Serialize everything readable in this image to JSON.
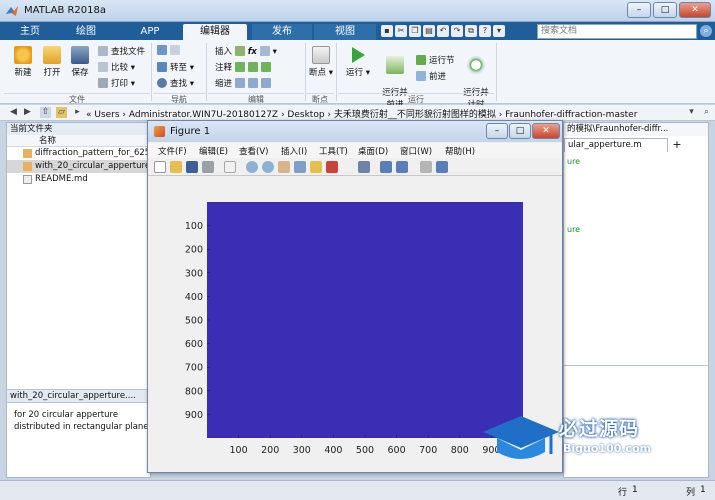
{
  "app": {
    "title": "MATLAB R2018a"
  },
  "main_tabs": [
    "主页",
    "绘图",
    "APP",
    "编辑器",
    "发布",
    "视图"
  ],
  "search": {
    "placeholder": "搜索文档"
  },
  "ribbon": {
    "file": {
      "new": "新建",
      "open": "打开",
      "save": "保存",
      "find_files": "查找文件",
      "compare": "比较",
      "print": "打印",
      "group": "文件"
    },
    "navigate": {
      "goto": "转至",
      "find": "查找",
      "group": "导航"
    },
    "edit": {
      "insert": "插入",
      "comment": "注释",
      "indent": "缩进",
      "fx": "fx",
      "group": "编辑"
    },
    "breakpoints": {
      "label": "断点",
      "group": "断点"
    },
    "run": {
      "run": "运行",
      "run_advance": "运行并\n前进",
      "run_section": "运行节",
      "advance": "前进",
      "run_time": "运行并\n计时",
      "group": "运行"
    }
  },
  "address": {
    "path": "« Users › Administrator.WIN7U-20180127Z › Desktop › 夫禾琅费衍射__不同形貌衍射图样的模拟 › Fraunhofer-diffraction-master"
  },
  "current_folder": {
    "title": "当前文件夹",
    "col_name": "名称",
    "files": [
      {
        "name": "diffraction_pattern_for_625"
      },
      {
        "name": "with_20_circular_apperture"
      },
      {
        "name": "README.md"
      }
    ],
    "detail_title": "with_20_circular_apperture....",
    "detail_text": [
      "for 20 circular apperture",
      "distributed in rectangular plane"
    ]
  },
  "editor": {
    "path": "的模拟\\Fraunhofer-diffr...",
    "tab": "ular_apperture.m",
    "code_lines": [
      "ure",
      "ure"
    ]
  },
  "status": {
    "row_label": "行",
    "row": "1",
    "col_label": "列",
    "col": "1"
  },
  "figure": {
    "title": "Figure 1",
    "menus": [
      "文件(F)",
      "编辑(E)",
      "查看(V)",
      "插入(I)",
      "工具(T)",
      "桌面(D)",
      "窗口(W)",
      "帮助(H)"
    ]
  },
  "chart_data": {
    "type": "heatmap",
    "title": "",
    "xlabel": "",
    "ylabel": "",
    "x_ticks": [
      100,
      200,
      300,
      400,
      500,
      600,
      700,
      800,
      900
    ],
    "y_ticks": [
      100,
      200,
      300,
      400,
      500,
      600,
      700,
      800,
      900
    ],
    "xlim": [
      0,
      1000
    ],
    "ylim": [
      0,
      1000
    ],
    "colors": {
      "background": "#3a2fb4"
    }
  },
  "watermark": {
    "cn": "必过源码",
    "en": "Biguo100.com"
  }
}
